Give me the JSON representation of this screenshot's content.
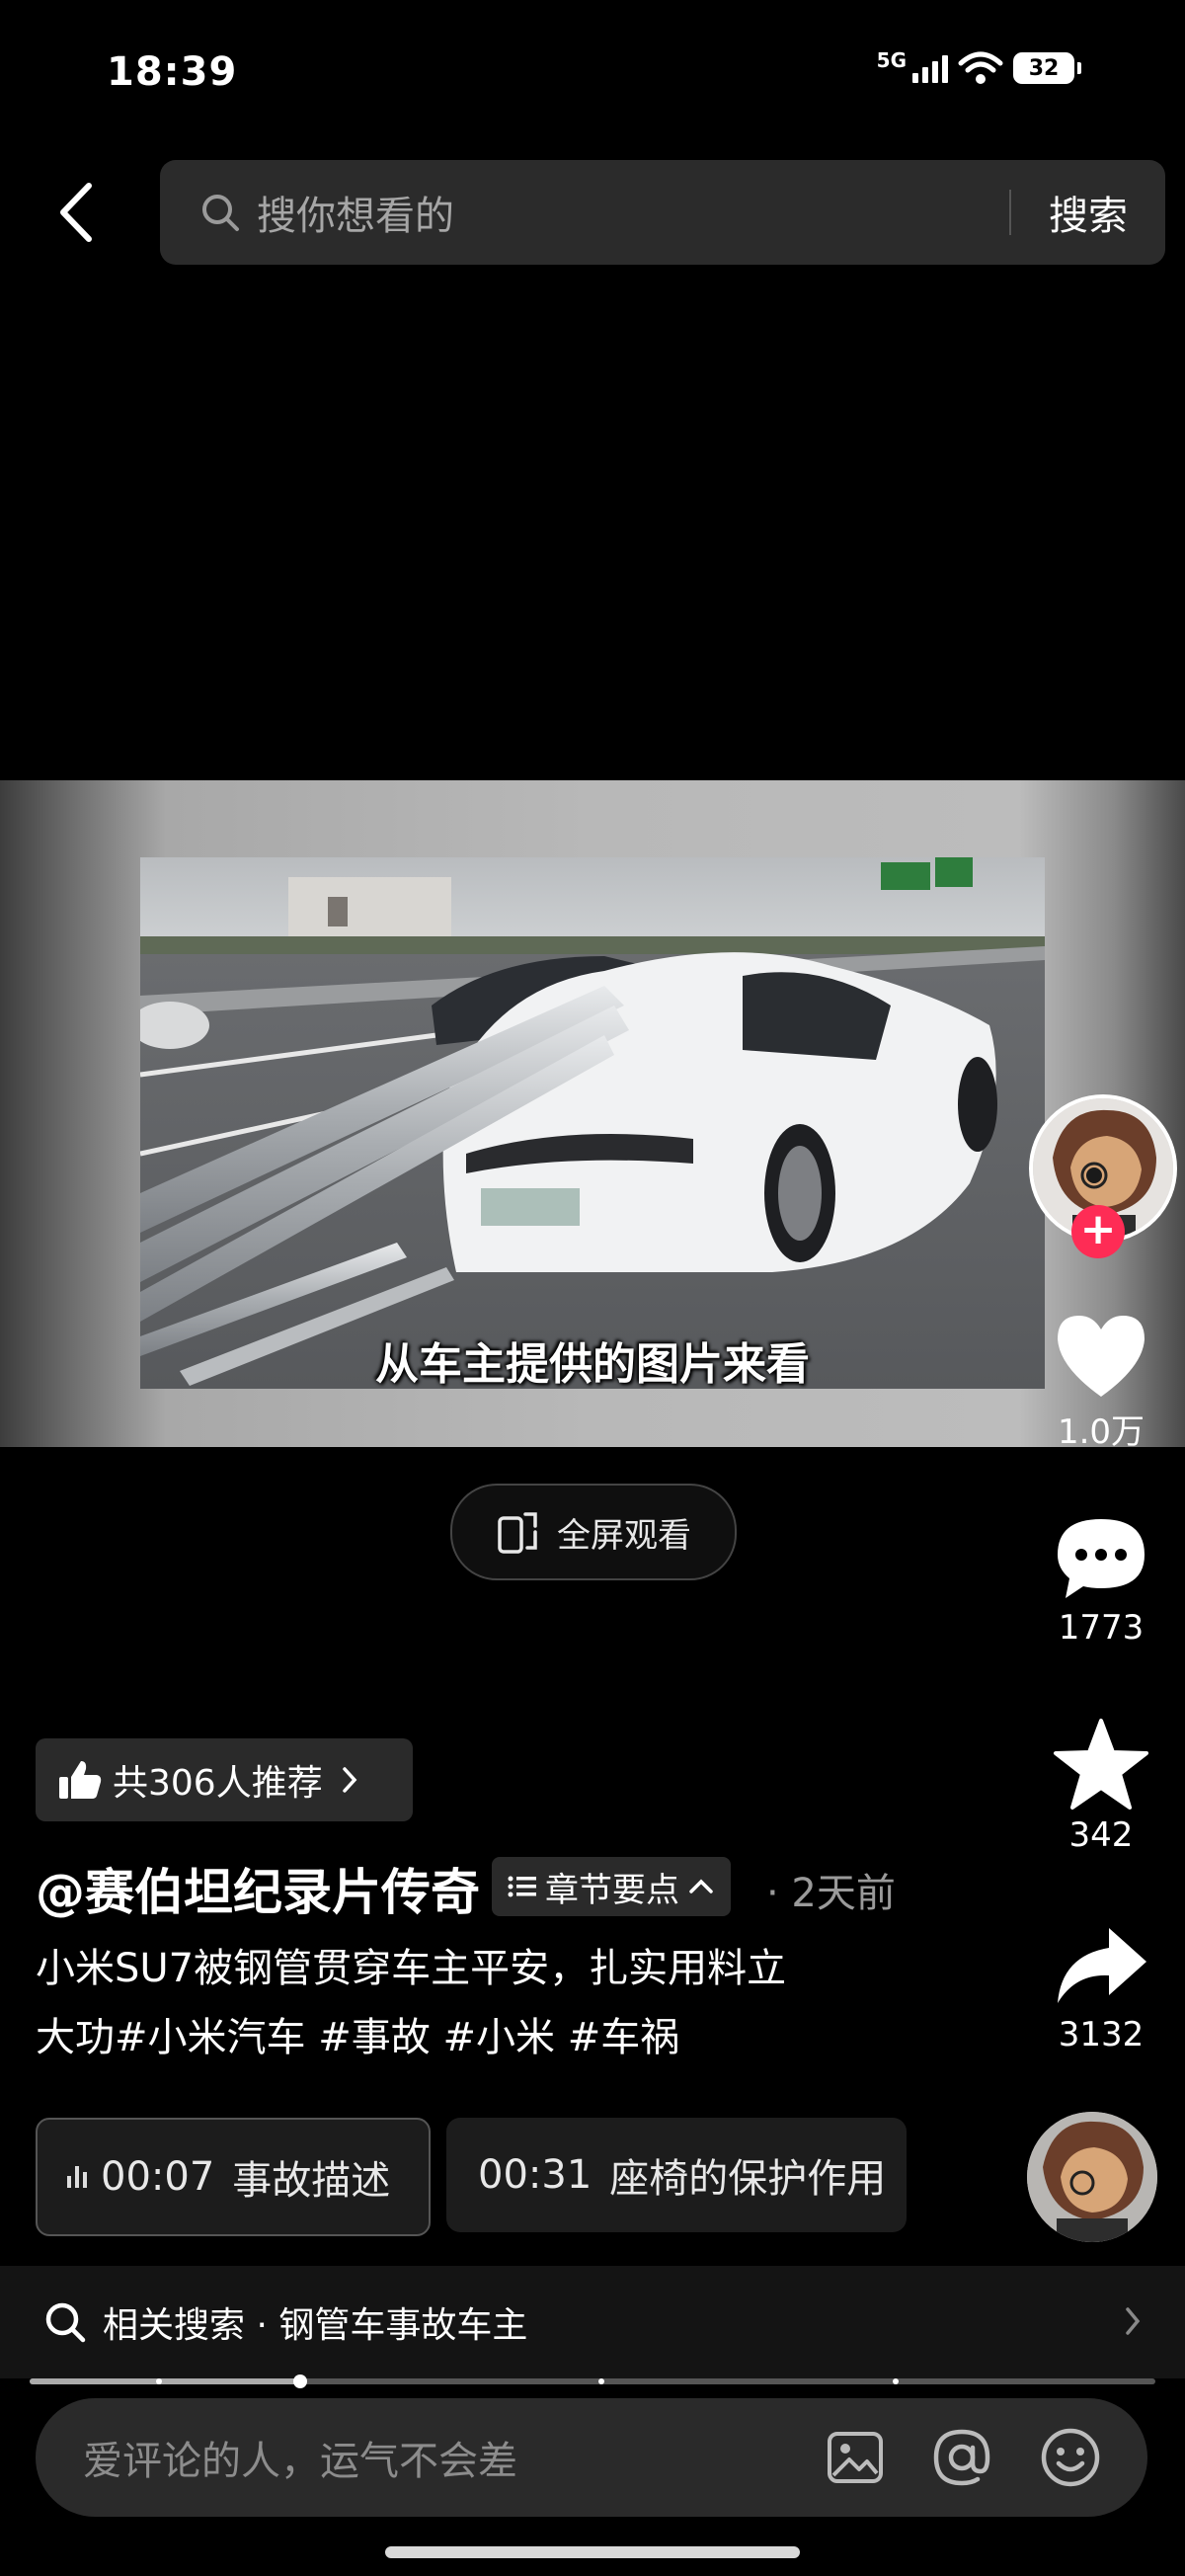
{
  "status_bar": {
    "time": "18:39",
    "network": "5G",
    "battery": "32"
  },
  "header": {
    "search_placeholder": "搜你想看的",
    "search_button": "搜索"
  },
  "video": {
    "subtitle": "从车主提供的图片来看",
    "fullscreen_label": "全屏观看"
  },
  "actions": {
    "likes": "1.0万",
    "comments": "1773",
    "favorites": "342",
    "shares": "3132"
  },
  "post": {
    "recommend": "共306人推荐",
    "author": "@赛伯坦纪录片传奇",
    "chapter_label": "章节要点",
    "time_ago": "· 2天前",
    "description_line1": "小米SU7被钢管贯穿车主平安，扎实用料立",
    "description_line2": "大功#小米汽车 #事故 #小米 #车祸"
  },
  "chapters": [
    {
      "time": "00:07",
      "title": "事故描述"
    },
    {
      "time": "00:31",
      "title": "座椅的保护作用"
    }
  ],
  "related_search": {
    "label": "相关搜索 · 钢管车事故车主"
  },
  "video_progress": 0.24,
  "comment_placeholder": "爱评论的人，运气不会差",
  "colors": {
    "follow": "#fe2c55",
    "background": "#000000"
  }
}
